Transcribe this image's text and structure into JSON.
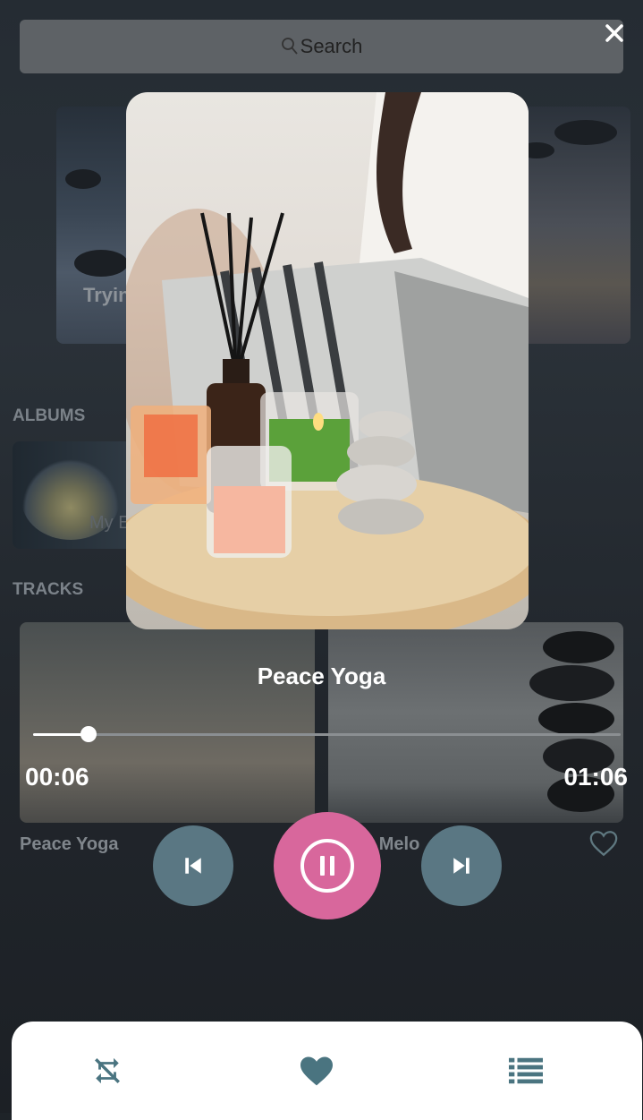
{
  "search": {
    "label": "Search"
  },
  "featured": {
    "title_fragment": "Tryin"
  },
  "sections": {
    "albums": "ALBUMS",
    "tracks": "TRACKS"
  },
  "album": {
    "title_fragment": "My E"
  },
  "tracks": [
    {
      "title": "Peace Yoga"
    },
    {
      "title_fragment": "n Melo"
    }
  ],
  "player": {
    "title": "Peace Yoga",
    "elapsed": "00:06",
    "duration": "01:06",
    "progress_fraction": 0.095
  },
  "colors": {
    "control_bg": "#5a7783",
    "play_bg": "#d8679c",
    "nav_icon": "#4a7480"
  },
  "icons": {
    "close": "close-icon",
    "prev": "skip-previous-icon",
    "play": "pause-icon",
    "next": "skip-next-icon",
    "shuffle": "repeat-off-icon",
    "favorite": "heart-icon",
    "playlist": "playlist-icon"
  }
}
